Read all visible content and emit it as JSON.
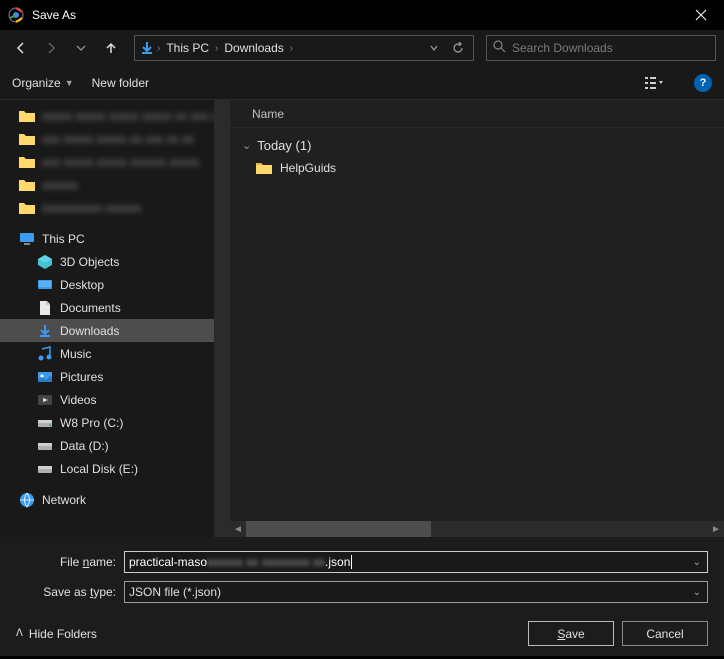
{
  "title": "Save As",
  "breadcrumb": {
    "location1": "This PC",
    "location2": "Downloads"
  },
  "search": {
    "placeholder": "Search Downloads"
  },
  "toolbar": {
    "organize": "Organize",
    "newfolder": "New folder"
  },
  "tree": {
    "blurred": [
      "xxxxx xxxxx xxxxx xxxxx xx xxx x",
      "xxx xxxxx xxxxx xx xxx xx xx",
      "xxx xxxxx xxxxx xxxxxx xxxxx",
      "xxxxxx",
      "xxxxxxxxxx xxxxxx"
    ],
    "thispc": "This PC",
    "items": [
      "3D Objects",
      "Desktop",
      "Documents",
      "Downloads",
      "Music",
      "Pictures",
      "Videos",
      "W8 Pro (C:)",
      "Data (D:)",
      "Local Disk (E:)"
    ],
    "network": "Network"
  },
  "content": {
    "header_name": "Name",
    "group": "Today (1)",
    "files": [
      "HelpGuids"
    ]
  },
  "fields": {
    "filename_label": "File name:",
    "filename_prefix": "practical-maso",
    "filename_blur": "xxxxxx xx xxxxxxxx xx",
    "filename_suffix": ".json",
    "type_label": "Save as type:",
    "type_value": "JSON file (*.json)"
  },
  "footer": {
    "hide": "Hide Folders",
    "save": "Save",
    "cancel": "Cancel"
  }
}
